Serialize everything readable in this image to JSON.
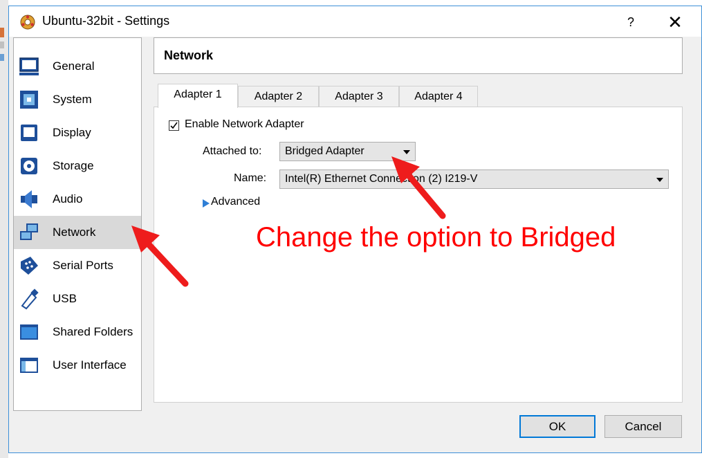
{
  "window": {
    "title": "Ubuntu-32bit - Settings",
    "help_label": "?",
    "close_label": "✕"
  },
  "sidebar": {
    "items": [
      {
        "label": "General",
        "icon": "monitor-icon"
      },
      {
        "label": "System",
        "icon": "chip-icon"
      },
      {
        "label": "Display",
        "icon": "display-icon"
      },
      {
        "label": "Storage",
        "icon": "storage-icon"
      },
      {
        "label": "Audio",
        "icon": "speaker-icon"
      },
      {
        "label": "Network",
        "icon": "network-icon",
        "selected": true
      },
      {
        "label": "Serial Ports",
        "icon": "serial-port-icon"
      },
      {
        "label": "USB",
        "icon": "usb-icon"
      },
      {
        "label": "Shared Folders",
        "icon": "folder-icon"
      },
      {
        "label": "User Interface",
        "icon": "window-icon"
      }
    ]
  },
  "main": {
    "header_title": "Network",
    "tabs": [
      {
        "label": "Adapter 1",
        "active": true
      },
      {
        "label": "Adapter 2"
      },
      {
        "label": "Adapter 3"
      },
      {
        "label": "Adapter 4"
      }
    ],
    "enable_label": "Enable Network Adapter",
    "enable_checked": true,
    "attached_label": "Attached to:",
    "attached_value": "Bridged Adapter",
    "name_label": "Name:",
    "name_value": "Intel(R) Ethernet Connection (2) I219-V",
    "advanced_label": "Advanced"
  },
  "annotation": {
    "text": "Change the option to Bridged",
    "color": "#ff0000"
  },
  "buttons": {
    "ok": "OK",
    "cancel": "Cancel"
  },
  "colors": {
    "window_border": "#3c8fd8",
    "selected_bg": "#d9d9d9",
    "ok_border": "#0078d7",
    "advanced_arrow": "#2f7fd6"
  }
}
